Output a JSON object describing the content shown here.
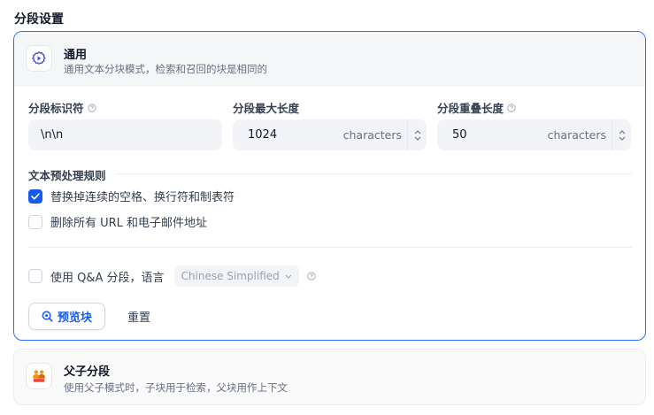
{
  "section": {
    "title": "分段设置"
  },
  "general": {
    "title": "通用",
    "description": "通用文本分块模式，检索和召回的块是相同的",
    "separator": {
      "label": "分段标识符",
      "value": "\\n\\n"
    },
    "max_length": {
      "label": "分段最大长度",
      "value": "1024",
      "unit": "characters"
    },
    "overlap": {
      "label": "分段重叠长度",
      "value": "50",
      "unit": "characters"
    },
    "rules": {
      "title": "文本预处理规则",
      "replace_spaces": {
        "label": "替换掉连续的空格、换行符和制表符",
        "checked": true
      },
      "remove_urls": {
        "label": "删除所有 URL 和电子邮件地址",
        "checked": false
      }
    },
    "qa": {
      "label": "使用 Q&A 分段，语言",
      "checked": false,
      "language": "Chinese Simplified"
    },
    "preview_label": "预览块",
    "reset_label": "重置"
  },
  "parent_child": {
    "title": "父子分段",
    "description": "使用父子模式时，子块用于检索，父块用作上下文"
  },
  "colors": {
    "accent": "#155aef",
    "border_active": "#296dff",
    "parent_icon": "#f79009"
  }
}
